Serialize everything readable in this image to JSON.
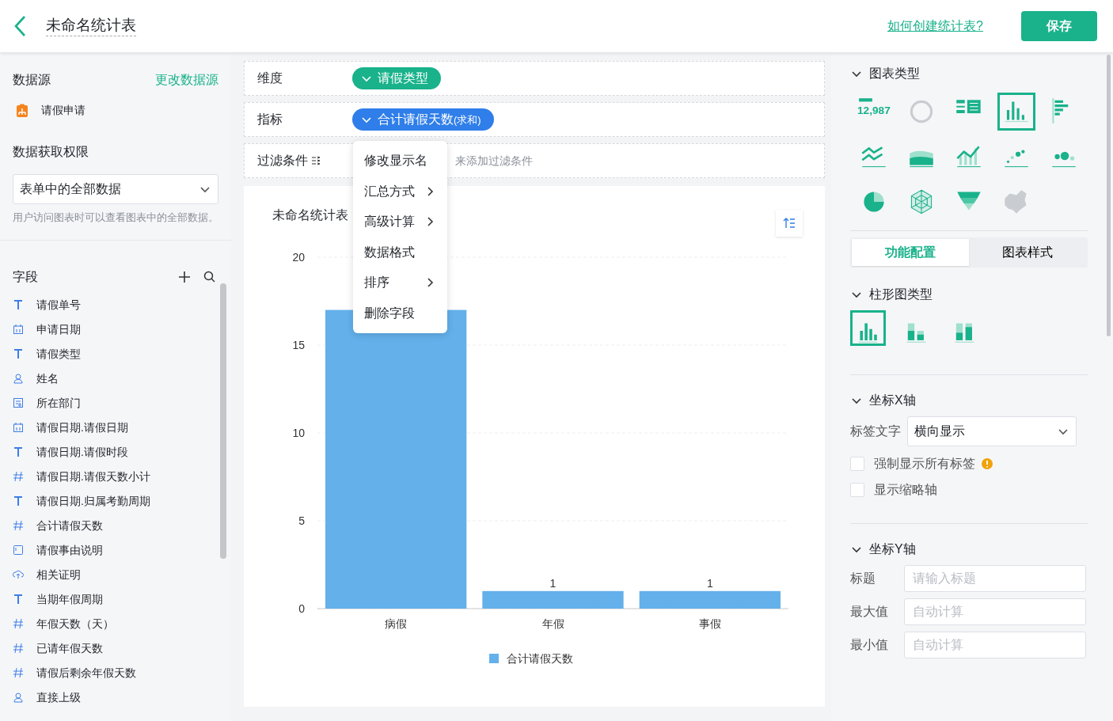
{
  "header": {
    "title": "未命名统计表",
    "help_link": "如何创建统计表?",
    "save_button": "保存"
  },
  "left_panel": {
    "datasource_label": "数据源",
    "change_link": "更改数据源",
    "datasource": "请假申请",
    "permission_label": "数据获取权限",
    "permission_value": "表单中的全部数据",
    "permission_hint": "用户访问图表时可以查看图表中的全部数据。",
    "fields_label": "字段",
    "fields": [
      {
        "kind": "text",
        "name": "请假单号"
      },
      {
        "kind": "date",
        "name": "申请日期"
      },
      {
        "kind": "text",
        "name": "请假类型"
      },
      {
        "kind": "user",
        "name": "姓名"
      },
      {
        "kind": "dept",
        "name": "所在部门"
      },
      {
        "kind": "date",
        "name": "请假日期.请假日期"
      },
      {
        "kind": "text",
        "name": "请假日期.请假时段"
      },
      {
        "kind": "number",
        "name": "请假日期.请假天数小计"
      },
      {
        "kind": "text",
        "name": "请假日期.归属考勤周期"
      },
      {
        "kind": "number",
        "name": "合计请假天数"
      },
      {
        "kind": "textarea",
        "name": "请假事由说明"
      },
      {
        "kind": "upload",
        "name": "相关证明"
      },
      {
        "kind": "text",
        "name": "当期年假周期"
      },
      {
        "kind": "number",
        "name": "年假天数（天）"
      },
      {
        "kind": "number",
        "name": "已请年假天数"
      },
      {
        "kind": "number",
        "name": "请假后剩余年假天数"
      },
      {
        "kind": "user",
        "name": "直接上级"
      }
    ]
  },
  "center": {
    "dimension_label": "维度",
    "dimension_pill": "请假类型",
    "metric_label": "指标",
    "metric_pill": "合计请假天数",
    "metric_suffix": "(求和)",
    "filter_label": "过滤条件",
    "filter_hint": "来添加过滤条件",
    "menu": [
      {
        "label": "修改显示名",
        "submenu": false
      },
      {
        "label": "汇总方式",
        "submenu": true
      },
      {
        "label": "高级计算",
        "submenu": true
      },
      {
        "label": "数据格式",
        "submenu": false
      },
      {
        "label": "排序",
        "submenu": true
      },
      {
        "label": "删除字段",
        "submenu": false
      }
    ],
    "chart_title": "未命名统计表",
    "chart_data": {
      "type": "bar",
      "categories": [
        "病假",
        "年假",
        "事假"
      ],
      "series": [
        {
          "name": "合计请假天数",
          "color": "#63b0eb",
          "values": [
            17,
            1,
            1
          ]
        }
      ],
      "ylim": [
        0,
        20
      ],
      "grid": true,
      "yticks": [
        0,
        5,
        10,
        15,
        20
      ],
      "value_labels": [
        null,
        "1",
        "1"
      ]
    }
  },
  "right_panel": {
    "chart_type_label": "图表类型",
    "chart_types": [
      {
        "kind": "number",
        "label": "12,987",
        "selected": false,
        "disabled": false
      },
      {
        "kind": "gauge",
        "selected": false,
        "disabled": true
      },
      {
        "kind": "table",
        "selected": false,
        "disabled": false
      },
      {
        "kind": "bar",
        "selected": true,
        "disabled": false
      },
      {
        "kind": "hbar",
        "selected": false,
        "disabled": false
      },
      {
        "kind": "line",
        "selected": false,
        "disabled": false
      },
      {
        "kind": "area",
        "selected": false,
        "disabled": false
      },
      {
        "kind": "combo",
        "selected": false,
        "disabled": false
      },
      {
        "kind": "scatter",
        "selected": false,
        "disabled": false
      },
      {
        "kind": "bubble",
        "selected": false,
        "disabled": false
      },
      {
        "kind": "pie",
        "selected": false,
        "disabled": false
      },
      {
        "kind": "radar",
        "selected": false,
        "disabled": false
      },
      {
        "kind": "funnel",
        "selected": false,
        "disabled": false
      },
      {
        "kind": "map",
        "selected": false,
        "disabled": true
      }
    ],
    "tabs": [
      {
        "label": "功能配置",
        "selected": true
      },
      {
        "label": "图表样式",
        "selected": false
      }
    ],
    "bar_type_label": "柱形图类型",
    "bar_types": [
      {
        "kind": "grouped",
        "selected": true
      },
      {
        "kind": "stacked",
        "selected": false
      },
      {
        "kind": "percent",
        "selected": false
      }
    ],
    "x_axis_label": "坐标X轴",
    "label_text_label": "标签文字",
    "label_text_value": "横向显示",
    "x_options": [
      {
        "label": "强制显示所有标签",
        "checked": false,
        "warning": true
      },
      {
        "label": "显示缩略轴",
        "checked": false,
        "warning": false
      }
    ],
    "y_axis_label": "坐标Y轴",
    "y_fields": [
      {
        "label": "标题",
        "placeholder": "请输入标题"
      },
      {
        "label": "最大值",
        "placeholder": "自动计算"
      },
      {
        "label": "最小值",
        "placeholder": "自动计算"
      }
    ]
  }
}
